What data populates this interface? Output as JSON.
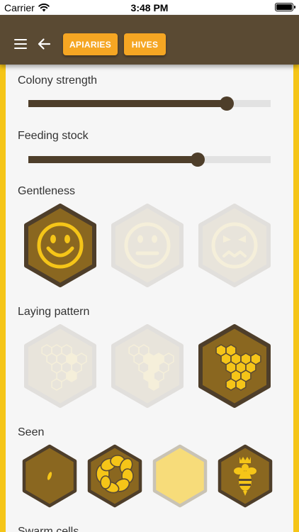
{
  "status_bar": {
    "carrier": "Carrier",
    "time": "3:48 PM"
  },
  "app_bar": {
    "menu_icon": "menu-icon",
    "back_icon": "arrow-left-icon",
    "chips": [
      {
        "label": "APIARIES"
      },
      {
        "label": "HIVES"
      }
    ]
  },
  "colors": {
    "app_bar": "#5a4a33",
    "chip": "#f5a623",
    "side_bars": "#f5c518",
    "hex_selected_border": "#4e3e2a",
    "hex_selected_fill": "#8a6720",
    "hex_icon": "#f5c518",
    "hex_unselected": "#ece7d8"
  },
  "sections": {
    "colony_strength": {
      "title": "Colony strength",
      "value": 0.82
    },
    "feeding_stock": {
      "title": "Feeding stock",
      "value": 0.7
    },
    "gentleness": {
      "title": "Gentleness",
      "options": [
        {
          "icon": "happy-face-icon",
          "selected": true
        },
        {
          "icon": "neutral-face-icon",
          "selected": false
        },
        {
          "icon": "angry-face-icon",
          "selected": false
        }
      ]
    },
    "laying_pattern": {
      "title": "Laying pattern",
      "options": [
        {
          "icon": "sparse-brood-icon",
          "selected": false
        },
        {
          "icon": "partial-brood-icon",
          "selected": false
        },
        {
          "icon": "compact-brood-icon",
          "selected": true
        }
      ]
    },
    "seen": {
      "title": "Seen",
      "options": [
        {
          "icon": "egg-icon",
          "selected": true
        },
        {
          "icon": "larva-icon",
          "selected": true
        },
        {
          "icon": "capped-cell-icon",
          "selected": false
        },
        {
          "icon": "queen-bee-icon",
          "selected": true
        }
      ]
    },
    "swarm_cells": {
      "title": "Swarm cells"
    }
  }
}
